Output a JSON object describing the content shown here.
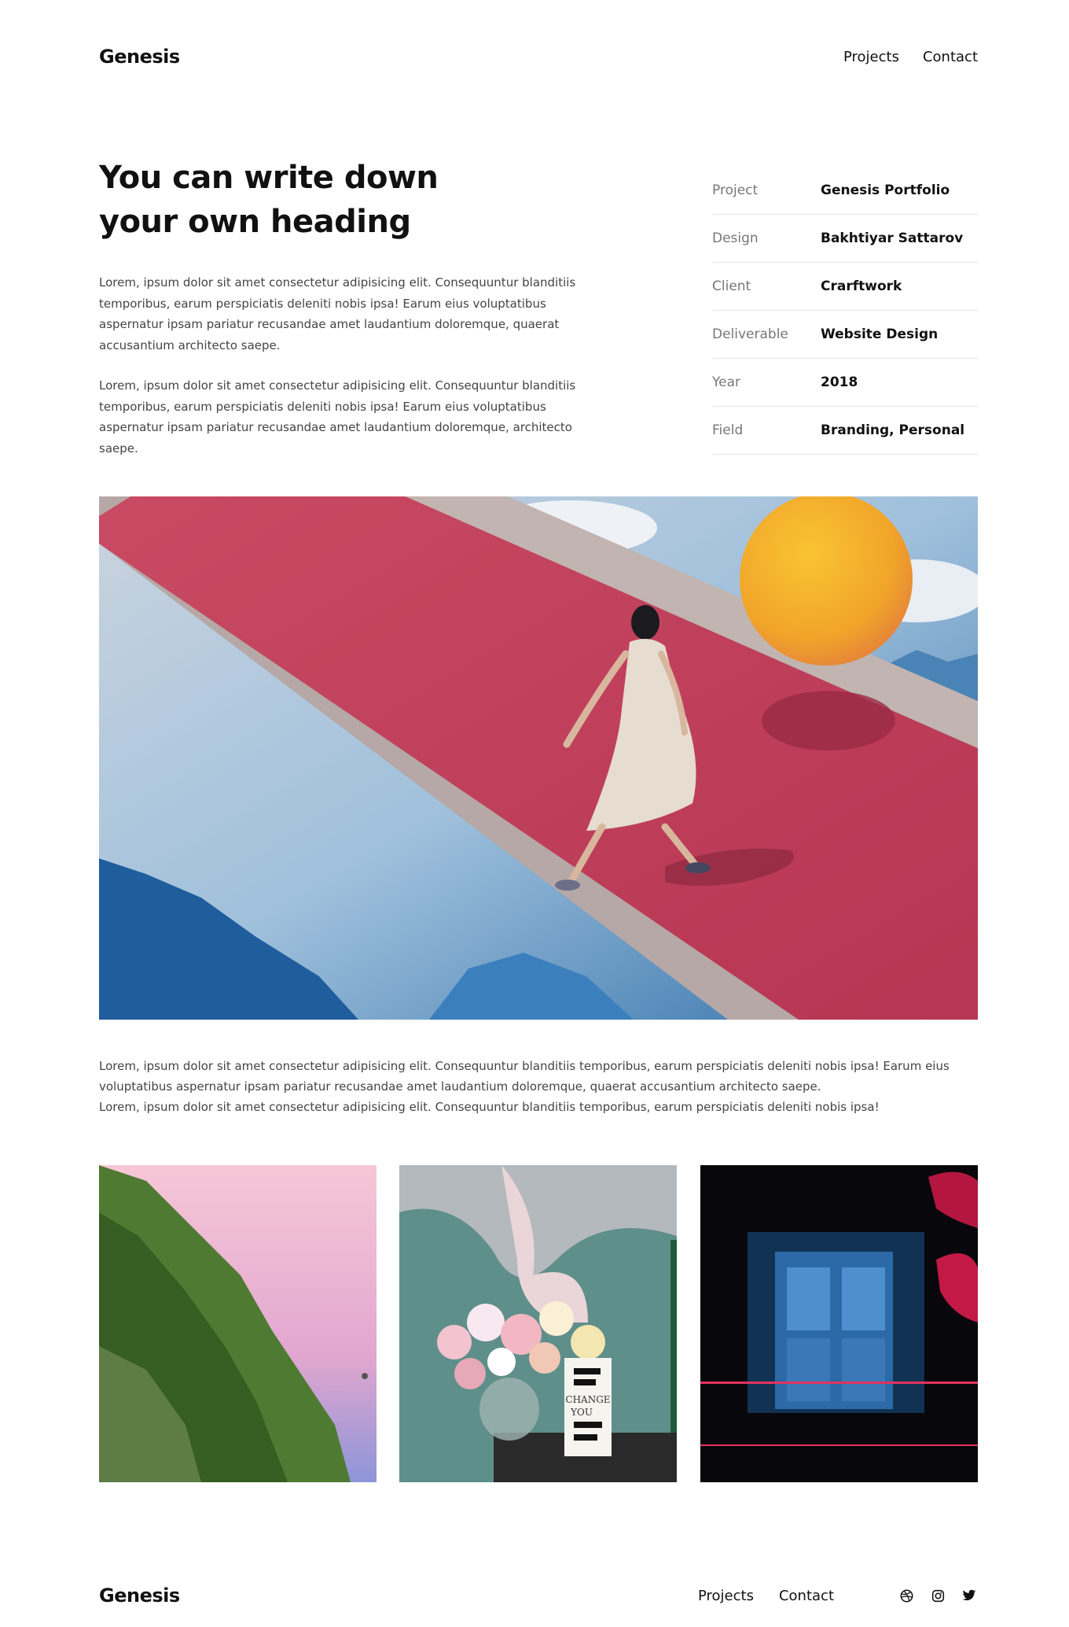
{
  "header": {
    "logo": "Genesis",
    "nav": [
      {
        "label": "Projects"
      },
      {
        "label": "Contact"
      }
    ]
  },
  "intro": {
    "heading": "You can write down your own heading",
    "paragraphs": [
      "Lorem, ipsum dolor sit amet consectetur adipisicing elit. Consequuntur blanditiis temporibus, earum perspiciatis deleniti nobis ipsa! Earum eius voluptatibus aspernatur ipsam pariatur recusandae amet laudantium doloremque, quaerat accusantium architecto saepe.",
      "Lorem, ipsum dolor sit amet consectetur adipisicing elit. Consequuntur blanditiis temporibus, earum perspiciatis deleniti nobis ipsa! Earum eius voluptatibus aspernatur ipsam pariatur recusandae amet laudantium doloremque, architecto saepe."
    ]
  },
  "meta": [
    {
      "label": "Project",
      "value": "Genesis Portfolio"
    },
    {
      "label": "Design",
      "value": "Bakhtiyar Sattarov"
    },
    {
      "label": "Client",
      "value": "Crarftwork"
    },
    {
      "label": "Deliverable",
      "value": "Website Design"
    },
    {
      "label": "Year",
      "value": "2018"
    },
    {
      "label": "Field",
      "value": "Branding, Personal"
    }
  ],
  "body": {
    "lines": [
      "Lorem, ipsum dolor sit amet consectetur adipisicing elit. Consequuntur blanditiis temporibus, earum perspiciatis deleniti nobis ipsa! Earum eius voluptatibus aspernatur ipsam pariatur recusandae amet laudantium doloremque, quaerat accusantium architecto saepe.",
      "Lorem, ipsum dolor sit amet consectetur adipisicing elit. Consequuntur blanditiis temporibus, earum perspiciatis deleniti nobis ipsa!"
    ]
  },
  "gallery": {
    "tile2_book": [
      "CHANGE",
      "YOU"
    ]
  },
  "footer": {
    "logo": "Genesis",
    "nav": [
      {
        "label": "Projects"
      },
      {
        "label": "Contact"
      }
    ],
    "social_icons": [
      "dribbble-icon",
      "instagram-icon",
      "twitter-icon"
    ]
  }
}
